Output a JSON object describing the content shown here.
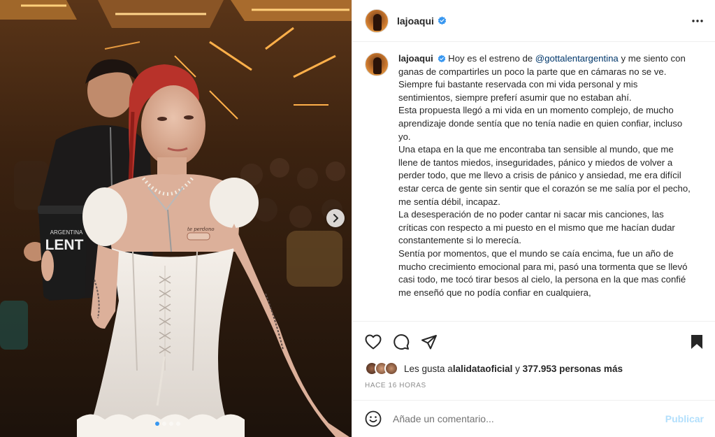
{
  "post": {
    "username": "lajoaqui",
    "verified": true
  },
  "media": {
    "cup_text": "ARGENTINA\nLENT",
    "carousel_dots": 4,
    "active_dot": 0,
    "tattoo_text": "te perdono"
  },
  "caption": {
    "username": "lajoaqui",
    "intro_before": " Hoy es el estreno de ",
    "mention": "@gottalentargentina",
    "intro_after": " y me siento con ganas de compartirles un poco la parte que en cámaras no se ve.",
    "p1": "Siempre fui bastante reservada con mi vida personal y mis sentimientos, siempre preferí asumir que no estaban ahí.",
    "p2": "Esta propuesta llegó a mi vida en un momento complejo, de mucho aprendizaje donde sentía que no tenía nadie en quien confiar, incluso yo.",
    "p3": "Una etapa en la que me encontraba tan sensible al mundo, que me llene de tantos miedos, inseguridades, pánico y miedos de volver a perder todo, que me llevo a crisis de pánico y ansiedad, me era difícil estar cerca de gente sin sentir que el corazón se me salía por el pecho, me sentía débil, incapaz.",
    "p4": "La desesperación de no poder cantar ni sacar mis canciones, las críticas con respecto a mi puesto en el mismo que me hacían dudar constantemente si lo merecía.",
    "p5": "Sentía por momentos, que el mundo se caía encima, fue un año de mucho crecimiento emocional para mi, pasó una tormenta que se llevó casi todo, me tocó tirar besos al cielo, la persona en la que mas confié me enseñó que no podía confiar en cualquiera,"
  },
  "likes": {
    "prefix": "Les gusta a ",
    "liker": "lalidataoficial",
    "middle": " y ",
    "count": "377.953 personas más"
  },
  "timestamp": "HACE 16 HORAS",
  "comment": {
    "placeholder": "Añade un comentario...",
    "publish_label": "Publicar"
  },
  "colors": {
    "verified": "#3897f0",
    "mention": "#00376b",
    "publish": "#b2dffc",
    "muted": "#8e8e8e"
  },
  "icons": [
    "verified-badge-icon",
    "more-options-icon",
    "heart-icon",
    "comment-icon",
    "share-icon",
    "bookmark-icon",
    "emoji-icon",
    "chevron-right-icon"
  ]
}
